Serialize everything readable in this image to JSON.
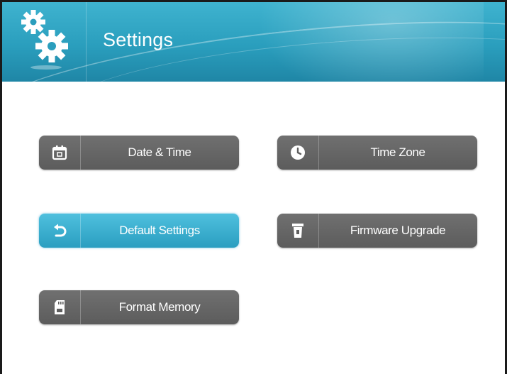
{
  "header": {
    "title": "Settings",
    "icon": "gears-icon"
  },
  "buttons": [
    {
      "id": "date-time",
      "label": "Date & Time",
      "icon": "calendar-icon",
      "active": false
    },
    {
      "id": "time-zone",
      "label": "Time Zone",
      "icon": "clock-icon",
      "active": false
    },
    {
      "id": "default-settings",
      "label": "Default Settings",
      "icon": "undo-icon",
      "active": true
    },
    {
      "id": "firmware-upgrade",
      "label": "Firmware Upgrade",
      "icon": "firmware-icon",
      "active": false
    },
    {
      "id": "format-memory",
      "label": "Format Memory",
      "icon": "sd-card-icon",
      "active": false
    }
  ],
  "colors": {
    "header": "#2a9ebd",
    "button": "#666666",
    "button_active": "#3aaed0"
  }
}
